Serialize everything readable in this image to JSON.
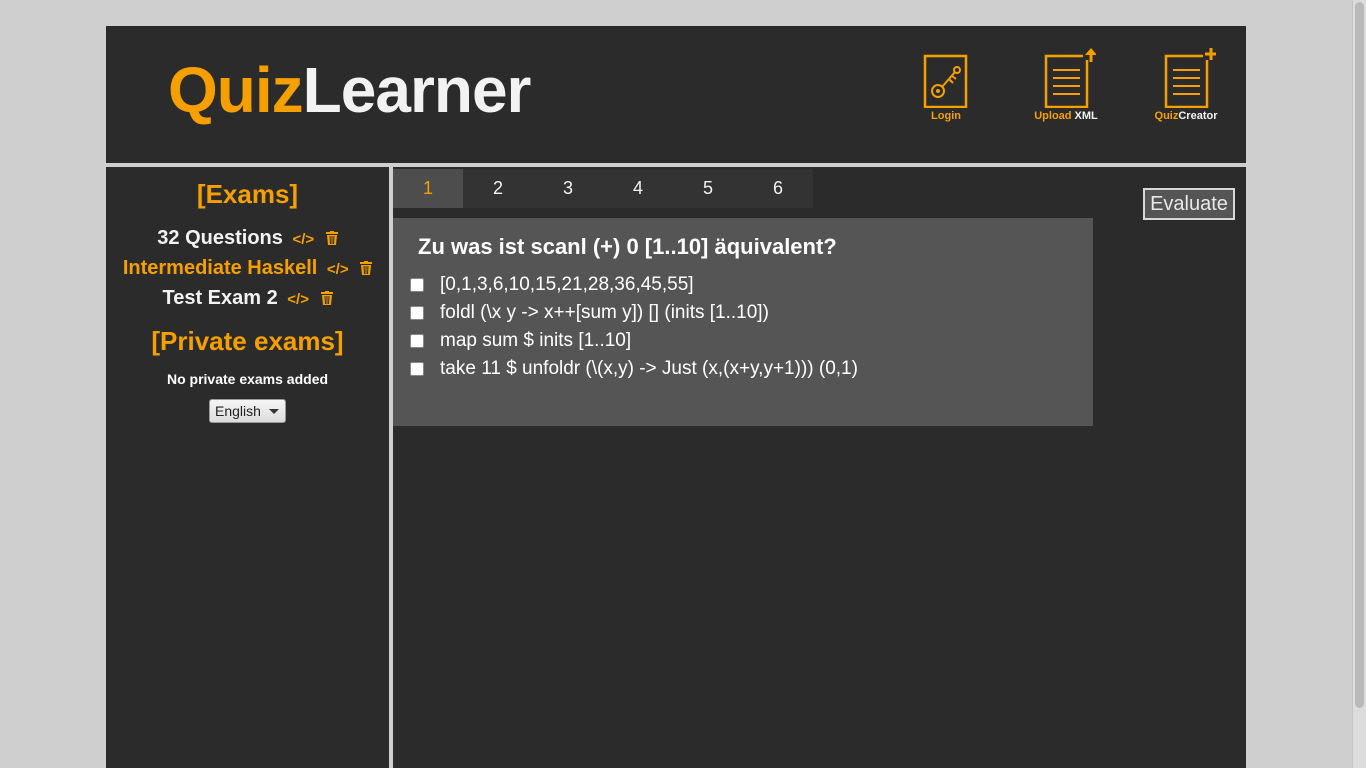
{
  "header": {
    "logo_part1": "Quiz",
    "logo_part2": "Learner",
    "buttons": [
      {
        "label_a": "Login",
        "label_b": "",
        "icon": "key-document-icon"
      },
      {
        "label_a": "Upload",
        "label_b": " XML",
        "icon": "upload-document-icon"
      },
      {
        "label_a": "Quiz",
        "label_b": "Creator",
        "icon": "new-document-icon"
      }
    ]
  },
  "sidebar": {
    "exams_title": "[Exams]",
    "exams": [
      {
        "name": "32 Questions",
        "code_label": "</>",
        "color": "white"
      },
      {
        "name": "Intermediate Haskell",
        "code_label": "</>",
        "color": "orange"
      },
      {
        "name": "Test Exam 2",
        "code_label": "</>",
        "color": "white"
      }
    ],
    "private_title": "[Private exams]",
    "no_private": "No private exams added",
    "language": "English"
  },
  "tabs": [
    "1",
    "2",
    "3",
    "4",
    "5",
    "6"
  ],
  "active_tab": 0,
  "evaluate_label": "Evaluate",
  "question": {
    "text": "Zu was ist scanl (+) 0 [1..10] äquivalent?",
    "answers": [
      "[0,1,3,6,10,15,21,28,36,45,55]",
      "foldl (\\x y -> x++[sum y]) [] (inits [1..10])",
      "map sum $ inits [1..10]",
      "take 11 $ unfoldr (\\(x,y) -> Just (x,(x+y,y+1))) (0,1)"
    ]
  },
  "colors": {
    "accent": "#f5a000",
    "background": "#2b2b2b",
    "panel": "#555555",
    "page_bg": "#cfcfcf"
  }
}
